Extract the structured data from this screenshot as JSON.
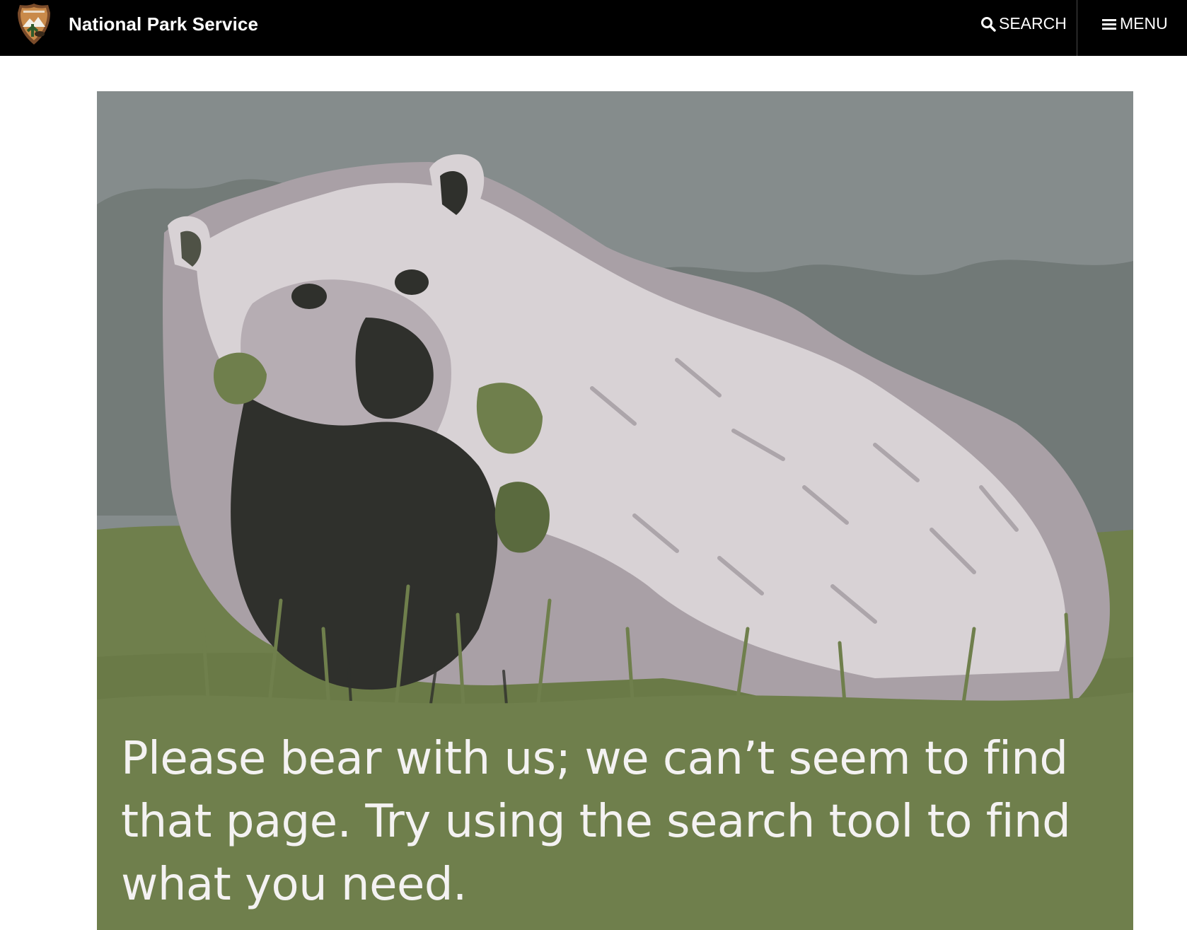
{
  "header": {
    "site_name": "National Park Service",
    "logo_icon": "nps-arrowhead-icon",
    "search_label": "SEARCH",
    "search_icon": "search-icon",
    "menu_label": "MENU",
    "menu_icon": "hamburger-icon",
    "background_color": "#000000"
  },
  "hero": {
    "image_subject": "grizzly bear in grass",
    "message": "Please bear with us; we can’t seem to find that page. Try using the search tool to find what you need.",
    "colors": {
      "sky": "#848b8b",
      "grass": "#6f7f4c",
      "fur_light": "#d9d3d6",
      "fur_shade": "#a79ea4",
      "dark": "#2f302c"
    }
  }
}
